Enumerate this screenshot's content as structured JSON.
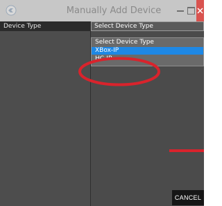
{
  "window": {
    "title": "Manually Add Device",
    "controls": [
      "minimize",
      "maximize",
      "close"
    ]
  },
  "form": {
    "device_type_label": "Device Type",
    "select": {
      "value": "Select Device Type"
    },
    "dropdown": {
      "options": [
        "Select Device Type",
        "XBox-IP",
        "HC-IP"
      ],
      "highlighted": "XBox-IP"
    }
  },
  "buttons": {
    "cancel": "CANCEL"
  },
  "colors": {
    "titlebar": "#c7c7c7",
    "background": "#4b4b4b",
    "highlight": "#1e88e5",
    "close": "#d9534f",
    "annotation": "#d9232c"
  },
  "icons": {
    "app": "app-logo-icon",
    "minimize": "minimize-icon",
    "maximize": "maximize-icon",
    "close": "close-icon"
  }
}
